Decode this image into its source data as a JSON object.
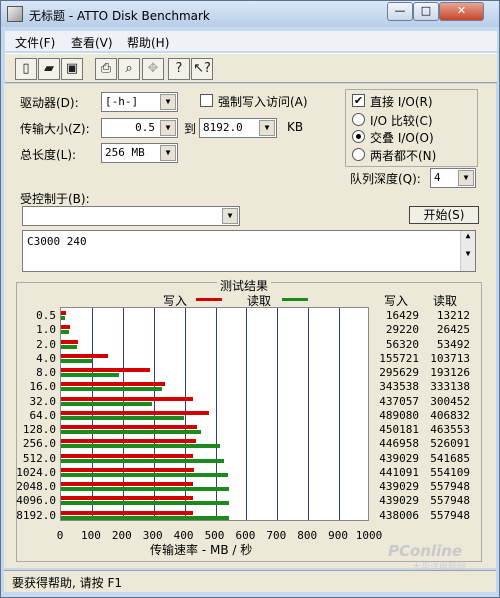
{
  "window": {
    "title": "无标题 - ATTO Disk Benchmark",
    "min": "—",
    "max": "□",
    "close": "✕"
  },
  "menu": {
    "file": "文件(F)",
    "view": "查看(V)",
    "help": "帮助(H)"
  },
  "toolbar": [
    "new-icon",
    "open-icon",
    "save-icon",
    "print-icon",
    "print-preview-icon",
    "move-icon",
    "help-icon",
    "context-help-icon"
  ],
  "settings": {
    "drive_label": "驱动器(D):",
    "drive_value": "[-h-]",
    "force_write_label": "强制写入访问(A)",
    "transfer_label": "传输大小(Z):",
    "transfer_from": "0.5",
    "transfer_to_label": "到",
    "transfer_to": "8192.0",
    "transfer_unit": "KB",
    "total_label": "总长度(L):",
    "total_value": "256 MB",
    "direct_io_label": "直接 I/O(R)",
    "io_compare_label": "I/O 比较(C)",
    "overlap_io_label": "交叠 I/O(O)",
    "neither_label": "两者都不(N)",
    "queue_depth_label": "队列深度(Q):",
    "queue_depth_value": "4",
    "controlled_by_label": "受控制于(B):",
    "start_button": "开始(S)",
    "description": "C3000 240"
  },
  "results": {
    "title": "测试结果",
    "legend_write": "写入",
    "legend_read": "读取",
    "col_write": "写入",
    "col_read": "读取",
    "xlabel": "传输速率 - MB / 秒"
  },
  "colors": {
    "write": "#d40000",
    "read": "#1d8a1d",
    "grid": "#2e3d8f"
  },
  "chart_data": {
    "type": "bar",
    "orientation": "horizontal",
    "categories": [
      "0.5",
      "1.0",
      "2.0",
      "4.0",
      "8.0",
      "16.0",
      "32.0",
      "64.0",
      "128.0",
      "256.0",
      "512.0",
      "1024.0",
      "2048.0",
      "4096.0",
      "8192.0"
    ],
    "series": [
      {
        "name": "写入",
        "values": [
          16429,
          29220,
          56320,
          155721,
          295629,
          343538,
          437057,
          489080,
          450181,
          446958,
          439029,
          441091,
          439029,
          439029,
          438006
        ]
      },
      {
        "name": "读取",
        "values": [
          13212,
          26425,
          53492,
          103713,
          193126,
          333138,
          300452,
          406832,
          463553,
          526091,
          541685,
          554109,
          557948,
          557948,
          557948
        ]
      }
    ],
    "xlabel": "传输速率 - MB / 秒",
    "xlim": [
      0,
      1000
    ],
    "xticks": [
      "0",
      "100",
      "200",
      "300",
      "400",
      "500",
      "600",
      "700",
      "800",
      "900",
      "1000"
    ],
    "grid": true,
    "legend": "top"
  },
  "watermark": {
    "main": "PConline",
    "sub": "太平洋电脑网"
  },
  "status": "要获得帮助, 请按 F1"
}
